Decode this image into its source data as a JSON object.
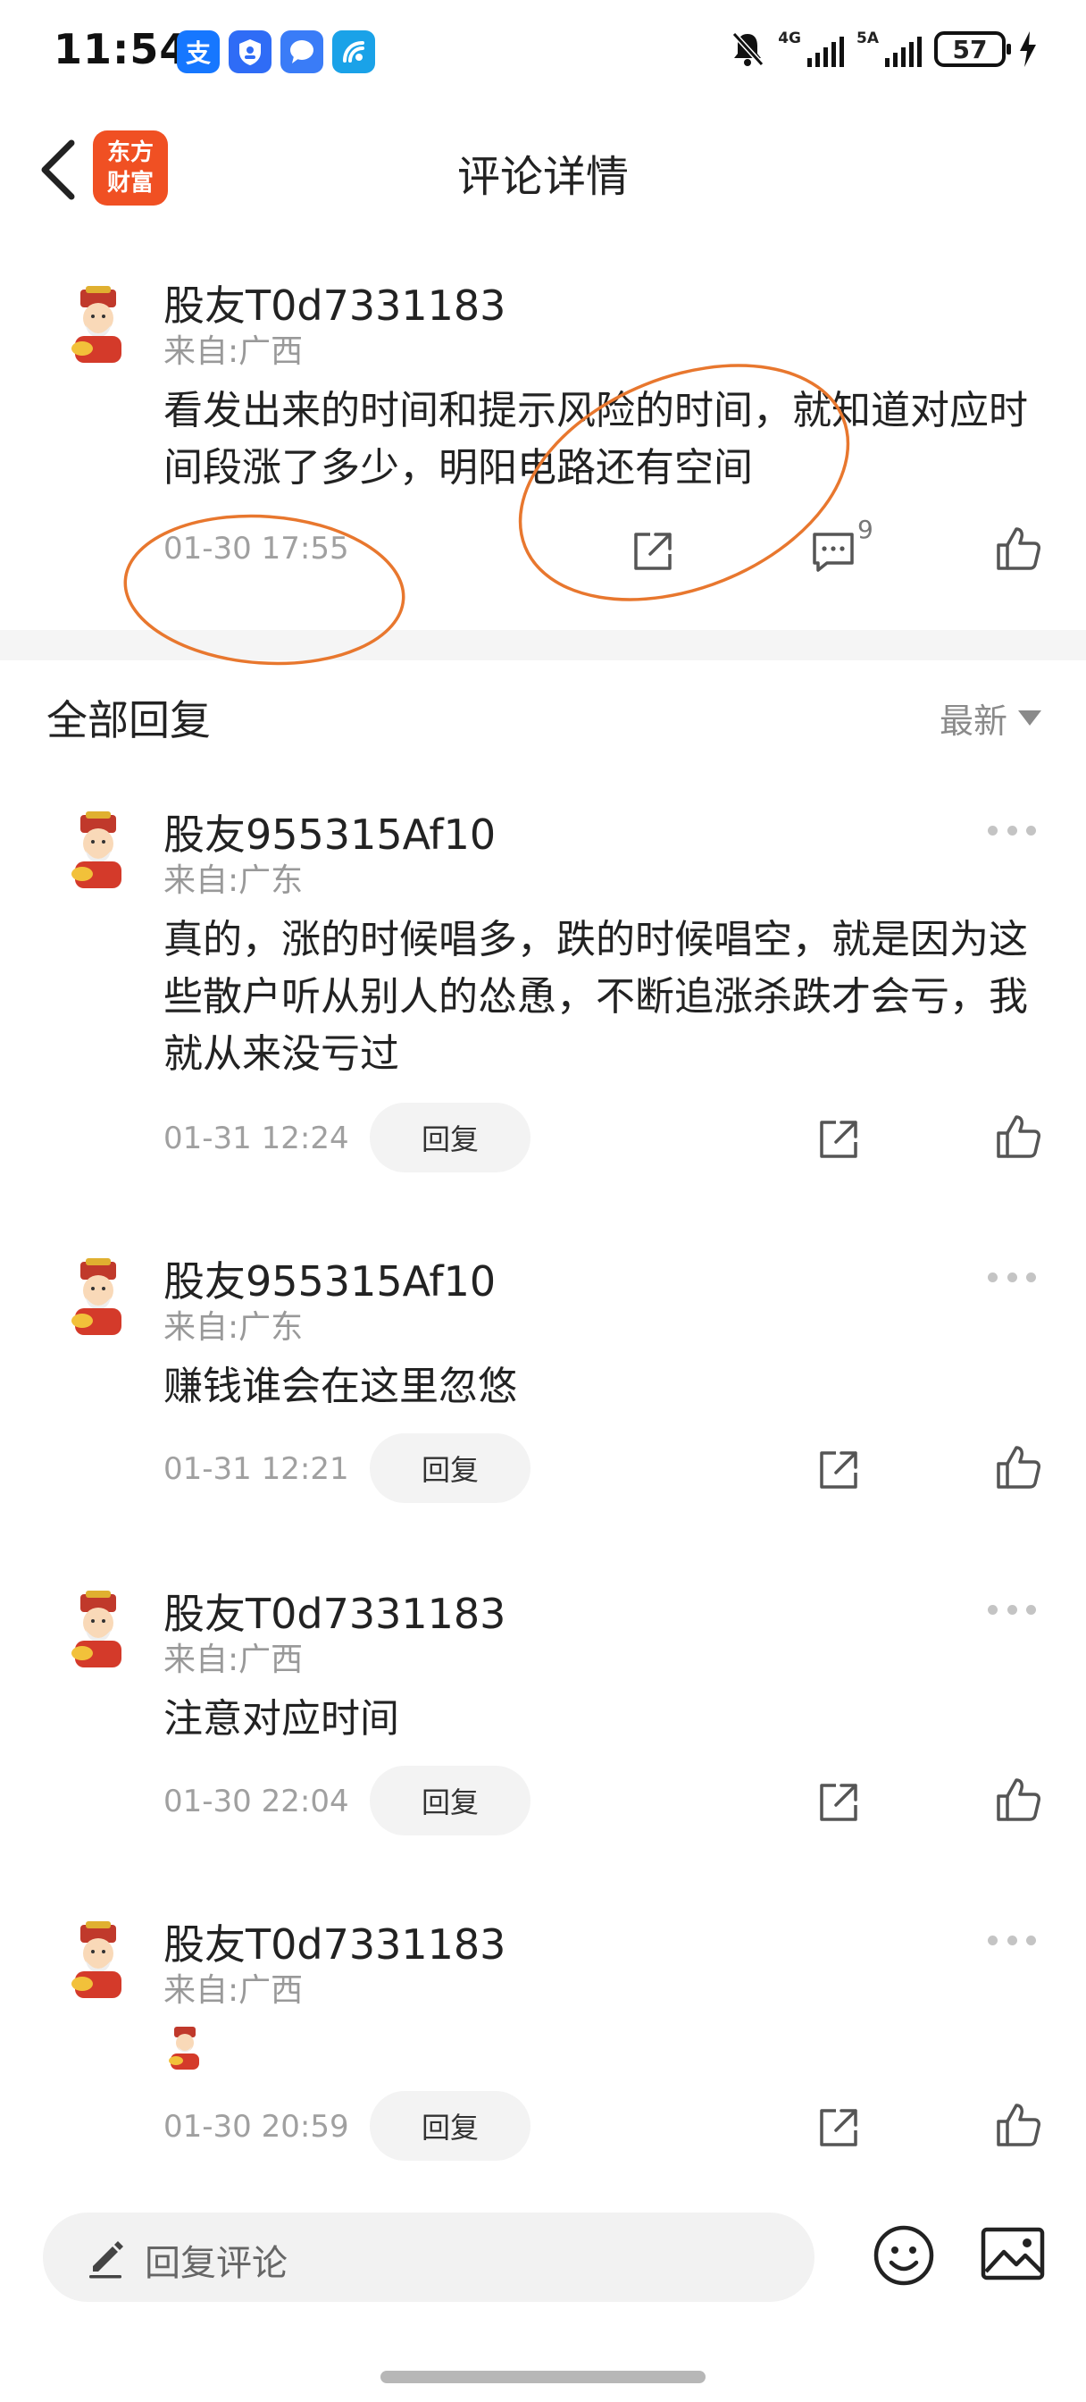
{
  "status_bar": {
    "time": "11:54",
    "apps": [
      {
        "icon": "alipay-icon",
        "glyph": "支",
        "color": "#1677ff"
      },
      {
        "icon": "shield-app-icon",
        "glyph": "⛉",
        "color": "#2f6cf6"
      },
      {
        "icon": "chat-app-icon",
        "glyph": "●",
        "color": "#3a7cf7"
      },
      {
        "icon": "signal-app-icon",
        "glyph": "◎",
        "color": "#1aa2e8"
      }
    ],
    "net1": "4G",
    "net2": "5A",
    "battery": "57"
  },
  "header": {
    "logo_line1": "东方",
    "logo_line2": "财富",
    "title": "评论详情"
  },
  "main_comment": {
    "user": "股友T0d7331183",
    "location": "来自:广西",
    "content": "看发出来的时间和提示风险的时间，就知道对应时间段涨了多少，明阳电路还有空间",
    "time": "01-30 17:55",
    "reply_count": "9"
  },
  "replies_section": {
    "title": "全部回复",
    "sort_label": "最新"
  },
  "replies": [
    {
      "user": "股友955315Af10",
      "location": "来自:广东",
      "content": "真的，涨的时候唱多，跌的时候唱空，就是因为这些散户听从别人的怂恿，不断追涨杀跌才会亏，我就从来没亏过",
      "time": "01-31 12:24",
      "reply_label": "回复"
    },
    {
      "user": "股友955315Af10",
      "location": "来自:广东",
      "content": "赚钱谁会在这里忽悠",
      "time": "01-31 12:21",
      "reply_label": "回复"
    },
    {
      "user": "股友T0d7331183",
      "location": "来自:广西",
      "content": "注意对应时间",
      "time": "01-30 22:04",
      "reply_label": "回复"
    },
    {
      "user": "股友T0d7331183",
      "location": "来自:广西",
      "content": "",
      "emoji": "fortune-god-emoji",
      "time": "01-30 20:59",
      "reply_label": "回复"
    }
  ],
  "bottom_bar": {
    "placeholder": "回复评论"
  },
  "annotation_color": "#e8772e"
}
